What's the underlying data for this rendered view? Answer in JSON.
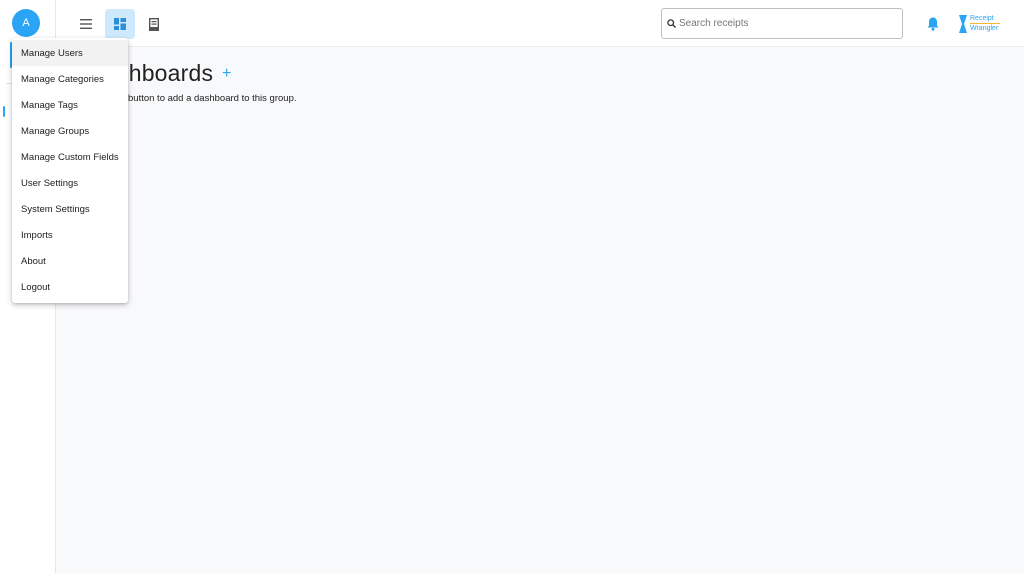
{
  "user": {
    "avatar_initial": "A"
  },
  "toolbar": {
    "menu_icon": "hamburger-icon",
    "dashboard_icon": "dashboard-grid-icon",
    "receipt_icon": "receipt-icon",
    "active_color": "#cfe9fc"
  },
  "search": {
    "placeholder": "Search receipts",
    "value": ""
  },
  "header": {
    "notification_icon": "bell-icon",
    "logo_line1": "Receipt",
    "logo_line2": "Wrangler"
  },
  "main": {
    "title_visible": "shboards",
    "add_label": "+",
    "helper_text": "button to add a dashboard to this group."
  },
  "user_menu": {
    "items": [
      {
        "label": "Manage Users"
      },
      {
        "label": "Manage Categories"
      },
      {
        "label": "Manage Tags"
      },
      {
        "label": "Manage Groups"
      },
      {
        "label": "Manage Custom Fields"
      },
      {
        "label": "User Settings"
      },
      {
        "label": "System Settings"
      },
      {
        "label": "Imports"
      },
      {
        "label": "About"
      },
      {
        "label": "Logout"
      }
    ]
  },
  "colors": {
    "accent": "#2ba4f5",
    "background": "#f8f9fb"
  }
}
